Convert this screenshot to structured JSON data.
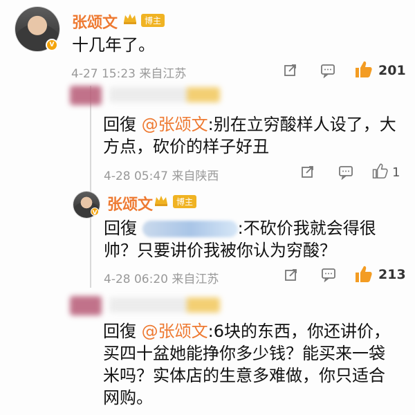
{
  "main_post": {
    "author_name": "张颂文",
    "owner_tag": "博主",
    "content": "十几年了。",
    "meta": "4-27 15:23 来自江苏",
    "like_count": "201"
  },
  "reply_1": {
    "prefix": "回復",
    "mention": "@张颂文",
    "text": ":别在立穷酸样人设了，大方点，砍价的样子好丑",
    "meta": "4-28 05:47 来自陕西",
    "like_count": "1"
  },
  "reply_2": {
    "author_name": "张颂文",
    "owner_tag": "博主",
    "prefix": "回復",
    "text": ":不砍价我就会得很帅？只要讲价我被你认为穷酸？",
    "meta": "4-28 06:20 来自江苏",
    "like_count": "213"
  },
  "reply_3": {
    "prefix": "回復",
    "mention": "@张颂文",
    "text": ":6块的东西，你还讲价，买四十盆她能挣你多少钱？能买来一袋米吗？实体店的生意多难做，你只适合网购。"
  },
  "colors": {
    "accent": "#ee7a32",
    "like": "#f39c23",
    "meta": "#999999"
  }
}
